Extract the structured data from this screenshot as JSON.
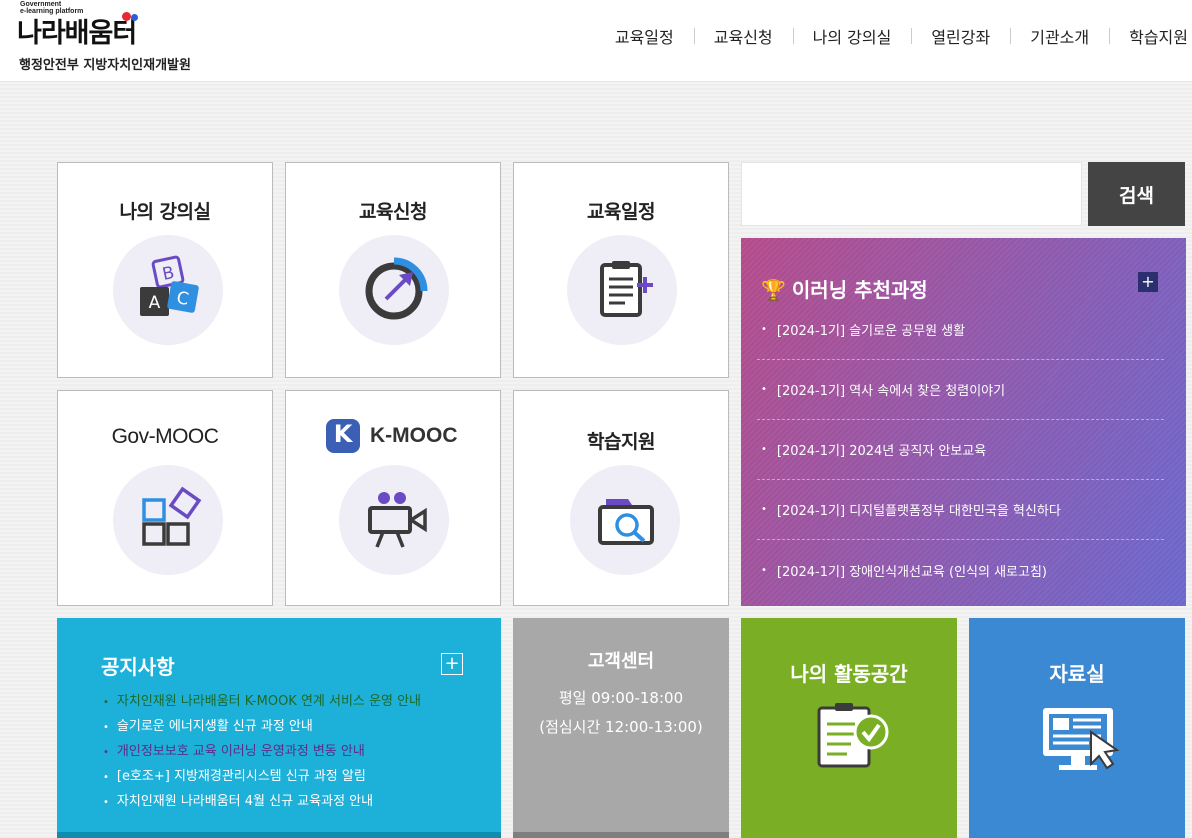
{
  "header": {
    "logo_small_line1": "Government",
    "logo_small_line2": "e-learning platform",
    "logo_text": "나라배움터",
    "subtitle": "행정안전부 지방자치인재개발원",
    "nav": [
      "교육일정",
      "교육신청",
      "나의 강의실",
      "열린강좌",
      "기관소개",
      "학습지원"
    ]
  },
  "tiles": [
    {
      "title": "나의 강의실",
      "icon": "abc-blocks-icon"
    },
    {
      "title": "교육신청",
      "icon": "progress-arrow-icon"
    },
    {
      "title": "교육일정",
      "icon": "clipboard-add-icon"
    },
    {
      "title": "Gov-MOOC",
      "icon": "squares-icon"
    },
    {
      "title": "K-MOOC",
      "icon": "video-camera-icon",
      "logo_letter": "K"
    },
    {
      "title": "학습지원",
      "icon": "folder-search-icon"
    }
  ],
  "search": {
    "placeholder": "",
    "button_label": "검색"
  },
  "recommend": {
    "trophy": "🏆",
    "title": "이러닝 추천과정",
    "plus": "+",
    "items": [
      "[2024-1기] 슬기로운 공무원 생활",
      "[2024-1기] 역사 속에서 찾은 청렴이야기",
      "[2024-1기] 2024년 공직자 안보교육",
      "[2024-1기] 디지털플랫폼정부 대한민국을 혁신하다",
      "[2024-1기] 장애인식개선교육 (인식의 새로고침)"
    ]
  },
  "notice": {
    "title": "공지사항",
    "plus": "+",
    "items": [
      "자치인재원 나라배움터 K-MOOK 연계 서비스 운영 안내",
      "슬기로운 에너지생활 신규 과정 안내",
      "개인정보보호 교육 이러닝 운영과정 변동 안내",
      "[e호조+] 지방재경관리시스템 신규 과정 알림",
      "자치인재원 나라배움터 4월 신규 교육과정 안내"
    ]
  },
  "customer_center": {
    "title": "고객센터",
    "hours": "평일 09:00-18:00",
    "lunch": "(점심시간 12:00-13:00)"
  },
  "activity": {
    "title": "나의 활동공간",
    "icon": "checklist-icon"
  },
  "archive": {
    "title": "자료실",
    "icon": "monitor-click-icon"
  },
  "colors": {
    "notice_bg": "#1db1d9",
    "cs_bg": "#a8a8a8",
    "activity_bg": "#7aaf25",
    "archive_bg": "#3a89d2",
    "icon_purple": "#6a4bc4",
    "icon_blue": "#2f8fe0"
  }
}
